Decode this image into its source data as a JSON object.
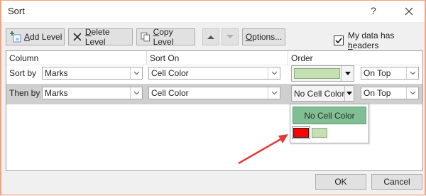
{
  "dialog": {
    "title": "Sort",
    "help_glyph": "?"
  },
  "toolbar": {
    "add_level": {
      "underline": "A",
      "rest": "dd Level"
    },
    "delete_level": {
      "underline": "D",
      "rest": "elete Level"
    },
    "copy_level": {
      "underline": "C",
      "rest": "opy Level"
    },
    "options": {
      "underline": "O",
      "rest": "ptions..."
    },
    "my_data_has_headers": {
      "before": "My data has ",
      "underline": "h",
      "after": "eaders",
      "checked": true
    }
  },
  "grid": {
    "headers": {
      "column": "Column",
      "sort_on": "Sort On",
      "order": "Order"
    },
    "rows": [
      {
        "label": "Sort by",
        "column": "Marks",
        "sort_on": "Cell Color",
        "order_color": "#c6e0b4",
        "position": "On Top"
      },
      {
        "label": "Then by",
        "column": "Marks",
        "sort_on": "Cell Color",
        "order_text": "No Cell Color",
        "position": "On Top"
      }
    ]
  },
  "color_popup": {
    "no_cell_color": "No Cell Color",
    "swatches": [
      {
        "name": "red",
        "color": "#ff0000"
      },
      {
        "name": "light-green",
        "color": "#c6e0b4"
      }
    ]
  },
  "annotation": {
    "arrow_color": "#e23b3b"
  },
  "footer": {
    "ok": "OK",
    "cancel": "Cancel"
  }
}
